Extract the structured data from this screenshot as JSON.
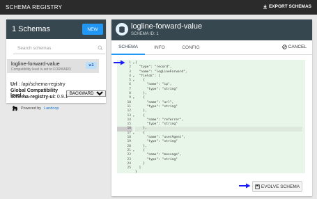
{
  "topbar": {
    "title": "SCHEMA REGISTRY",
    "export_label": "EXPORT SCHEMAS"
  },
  "sidebar": {
    "count_label": "1 Schemas",
    "new_label": "NEW",
    "search_placeholder": "Search schemas",
    "items": [
      {
        "name": "logline-forward-value",
        "subtitle": "Compatibility level is set to FORWARD",
        "version": "v.1"
      }
    ]
  },
  "info": {
    "url_label": "Url",
    "url_value": ": /api/schema-registry",
    "compat_label": "Global Compatibility level :",
    "compat_selected": "BACKWARD",
    "version_label": "schema-registry-ui:",
    "version_value": "0.9.1",
    "powered_label": "Powered by",
    "powered_link": "Landoop"
  },
  "subject": {
    "title": "logline-forward-value",
    "schema_id": "SCHEMA ID: 1"
  },
  "tabs": [
    "SCHEMA",
    "INFO",
    "CONFIG"
  ],
  "cancel_label": "CANCEL",
  "evolve_label": "EVOLVE SCHEMA",
  "editor": {
    "lines": [
      "{",
      "  \"type\": \"record\",",
      "  \"name\": \"logLineForward\",",
      "  \"fields\": [",
      "    {",
      "      \"name\": \"ip\",",
      "      \"type\": \"string\"",
      "    },",
      "    {",
      "      \"name\": \"url\",",
      "      \"type\": \"string\"",
      "    },",
      "    {",
      "      \"name\": \"referrer\",",
      "      \"type\": \"string\"",
      "    },",
      "    {",
      "      \"name\": \"userAgent\",",
      "      \"type\": \"string\"",
      "    },",
      "    {",
      "      \"name\": \"message\",",
      "      \"type\": \"string\"",
      "    }",
      "  ]",
      "}"
    ],
    "line_numbers": [
      "1",
      "2",
      "3",
      "4",
      "5",
      "6",
      "7",
      "8",
      "9",
      "10",
      "11",
      "12",
      "13",
      "14",
      "15",
      "16",
      "17",
      "18",
      "19",
      "20",
      "21",
      "22",
      "23",
      "24",
      "25"
    ],
    "highlight_line": 16
  },
  "colors": {
    "header": "#37474f",
    "accent": "#2196f3",
    "editor_bg": "#e8f5e9",
    "arrow": "#1a1aff"
  }
}
